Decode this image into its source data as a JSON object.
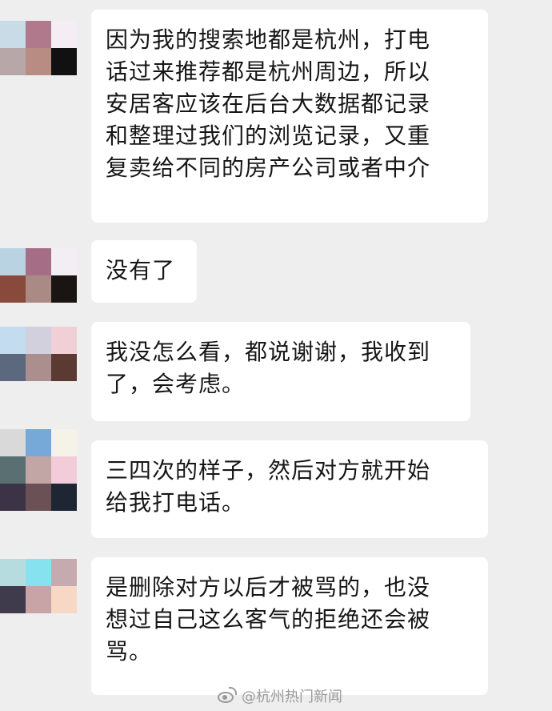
{
  "colors": {
    "background": "#eeeeee",
    "bubble": "#ffffff",
    "text": "#161616",
    "watermark": "#9a9a9a"
  },
  "messages": [
    {
      "text": "因为我的搜索地都是杭州，打电\n话过来推荐都是杭州周边，所以\n安居客应该在后台大数据都记录\n和整理过我们的浏览记录，又重\n复卖给不同的房产公司或者中介"
    },
    {
      "text": "没有了"
    },
    {
      "text": "我没怎么看，都说谢谢，我收到\n了，会考虑。"
    },
    {
      "text": "三四次的样子，然后对方就开始\n给我打电话。"
    },
    {
      "text": "是删除对方以后才被骂的，也没\n想过自己这么客气的拒绝还会被\n骂。"
    }
  ],
  "avatars": [
    {
      "icon": "pixelated-avatar",
      "tiles": [
        "#c9dbe6",
        "#b07a8c",
        "#f4eef4",
        "#b8a7a8",
        "#b88c82",
        "#111111"
      ]
    },
    {
      "icon": "pixelated-avatar",
      "tiles": [
        "#b9d3e3",
        "#a56e86",
        "#f3eef4",
        "#8a4a3b",
        "#a98a84",
        "#1a1513"
      ]
    },
    {
      "icon": "pixelated-avatar",
      "tiles": [
        "#c3dcef",
        "#d3d0de",
        "#f0cfd6",
        "#5b687e",
        "#ab8e8e",
        "#5b3a33"
      ]
    },
    {
      "icon": "pixelated-avatar",
      "tiles": [
        "#d9d9d9",
        "#76a8d8",
        "#f5f2e8",
        "#5a6f72",
        "#c2a6a6",
        "#f2ccd9",
        "#3c3446",
        "#6b5056",
        "#1d2632"
      ]
    },
    {
      "icon": "pixelated-avatar",
      "tiles": [
        "#b7dce0",
        "#86e2ef",
        "#c5aab0",
        "#3f3a4c",
        "#c8a4a6",
        "#f6d8c4"
      ]
    }
  ],
  "watermark": {
    "icon": "weibo-icon",
    "text": "@杭州热门新闻"
  }
}
